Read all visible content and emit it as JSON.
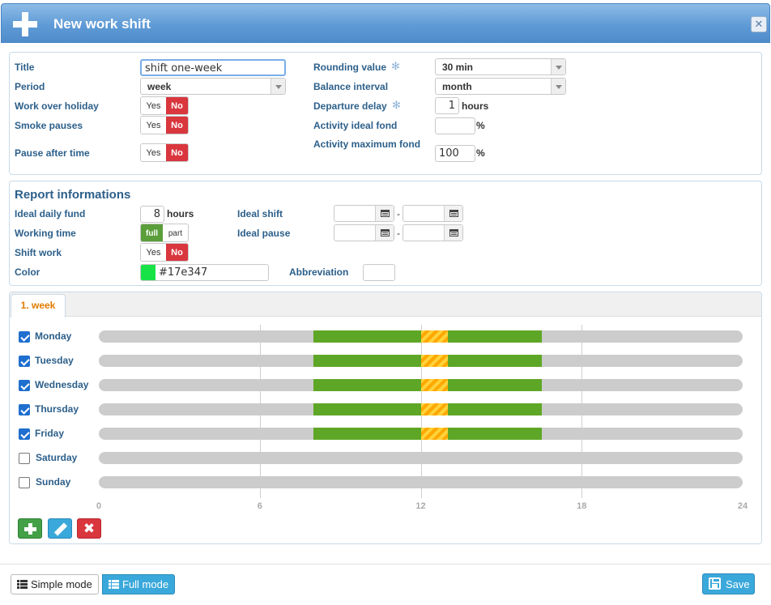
{
  "window": {
    "title": "New work shift"
  },
  "general": {
    "title_label": "Title",
    "title_value": "shift one-week",
    "period_label": "Period",
    "period_value": "week",
    "holiday_label": "Work over holiday",
    "smoke_label": "Smoke pauses",
    "pause_after_label": "Pause after time",
    "yes": "Yes",
    "no": "No",
    "rounding_label": "Rounding value",
    "rounding_value": "30 min",
    "balance_label": "Balance interval",
    "balance_value": "month",
    "departure_label": "Departure delay",
    "departure_value": "1",
    "departure_unit": "hours",
    "ideal_fond_label": "Activity ideal fond",
    "ideal_fond_value": "",
    "percent": "%",
    "max_fond_label": "Activity maximum fond",
    "max_fond_value": "100"
  },
  "report": {
    "heading": "Report informations",
    "daily_fund_label": "Ideal daily fund",
    "daily_fund_value": "8",
    "daily_fund_unit": "hours",
    "working_time_label": "Working time",
    "full": "full",
    "part": "part",
    "shift_work_label": "Shift work",
    "color_label": "Color",
    "color_value": "#17e347",
    "color_swatch": "#17e347",
    "ideal_shift_label": "Ideal shift",
    "ideal_pause_label": "Ideal pause",
    "dash": "-",
    "abbreviation_label": "Abbreviation",
    "abbreviation_value": ""
  },
  "week": {
    "tab_label": "1. week",
    "days": [
      {
        "name": "Monday",
        "checked": true
      },
      {
        "name": "Tuesday",
        "checked": true
      },
      {
        "name": "Wednesday",
        "checked": true
      },
      {
        "name": "Thursday",
        "checked": true
      },
      {
        "name": "Friday",
        "checked": true
      },
      {
        "name": "Saturday",
        "checked": false
      },
      {
        "name": "Sunday",
        "checked": false
      }
    ],
    "axis_ticks": [
      "0",
      "6",
      "12",
      "18",
      "24"
    ],
    "schedule": {
      "work_hours": [
        [
          8,
          12
        ],
        [
          13,
          16.5
        ]
      ],
      "pause_hours": [
        12,
        13
      ],
      "work_color": "#5ea726",
      "pause_color": "#ffc000"
    }
  },
  "footer": {
    "simple_mode": "Simple mode",
    "full_mode": "Full mode",
    "save": "Save"
  }
}
